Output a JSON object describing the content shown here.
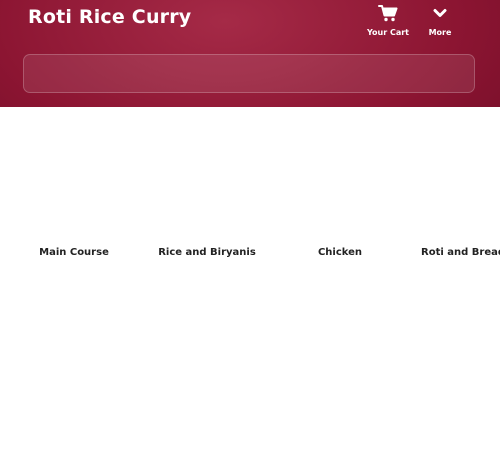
{
  "header": {
    "title": "Roti Rice Curry",
    "cart_label": "Your Cart",
    "more_label": "More"
  },
  "search": {
    "value": "",
    "placeholder": ""
  },
  "categories": [
    {
      "label": "Main Course"
    },
    {
      "label": "Rice and Biryanis"
    },
    {
      "label": "Chicken"
    },
    {
      "label": "Roti and Breads"
    }
  ],
  "colors": {
    "header_bg": "#8c1532",
    "header_text": "#ffffff",
    "category_text": "#222222",
    "page_bg": "#ffffff"
  },
  "icons": {
    "cart": "shopping-cart-icon",
    "more": "chevron-down-icon"
  }
}
